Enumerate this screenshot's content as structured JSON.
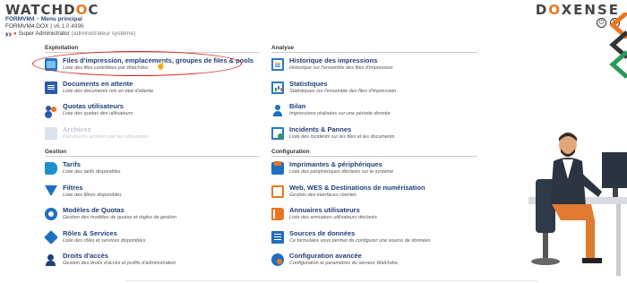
{
  "header": {
    "logo_left_main": "WATCHD",
    "logo_left_accent": "O",
    "logo_left_end": "C",
    "logo_right_start": "D",
    "logo_right_accent": "O",
    "logo_right_end": "XENSE",
    "breadcrumb_root": "FORMVM4",
    "breadcrumb_sep": ">",
    "breadcrumb_page": "Menu principal",
    "server": "FORMVM4.DOX",
    "version": "v6.1.0.4996",
    "user_role": "Super Administrator",
    "role_note": "(administrateur système)",
    "actions": [
      "power-icon",
      "refresh-icon"
    ]
  },
  "sections": {
    "exploitation": {
      "title": "Exploitation",
      "items": [
        {
          "label": "Files d'impression, emplacements, groupes de files & pools",
          "desc": "Liste des files contrôlées par Watchdoc",
          "icon": "print-queues-icon"
        },
        {
          "label": "Documents en attente",
          "desc": "Liste des documents mis en état d'attente",
          "icon": "pending-documents-icon"
        },
        {
          "label": "Quotas utilisateurs",
          "desc": "Liste des quotas des utilisateurs",
          "icon": "user-quotas-icon"
        },
        {
          "label": "Archives",
          "desc": "Documents archivés par les utilisateurs",
          "icon": "archives-icon"
        }
      ]
    },
    "gestion": {
      "title": "Gestion",
      "items": [
        {
          "label": "Tarifs",
          "desc": "Liste des tarifs disponibles",
          "icon": "pricing-icon"
        },
        {
          "label": "Filtres",
          "desc": "Liste des filtres disponibles",
          "icon": "filter-icon"
        },
        {
          "label": "Modèles de Quotas",
          "desc": "Gestion des modèles de quotas et règles de gestion",
          "icon": "quota-templates-icon"
        },
        {
          "label": "Rôles & Services",
          "desc": "Liste des rôles et services disponibles",
          "icon": "roles-services-icon"
        },
        {
          "label": "Droits d'accès",
          "desc": "Gestion des droits d'accès et profils d'administration",
          "icon": "access-rights-icon"
        }
      ]
    },
    "analyse": {
      "title": "Analyse",
      "items": [
        {
          "label": "Historique des impressions",
          "desc": "Historique sur l'ensemble des files d'impression",
          "icon": "print-history-icon"
        },
        {
          "label": "Statistiques",
          "desc": "Statistiques sur l'ensemble des files d'impression",
          "icon": "statistics-icon"
        },
        {
          "label": "Bilan",
          "desc": "Impressions réalisées sur une période donnée",
          "icon": "report-icon"
        },
        {
          "label": "Incidents & Pannes",
          "desc": "Liste des incidents sur les files et les documents",
          "icon": "incidents-icon"
        }
      ]
    },
    "configuration": {
      "title": "Configuration",
      "items": [
        {
          "label": "Imprimantes & périphériques",
          "desc": "Liste des périphériques déclarés sur le système",
          "icon": "printers-icon"
        },
        {
          "label": "Web, WES & Destinations de numérisation",
          "desc": "Gestion des interfaces clientes",
          "icon": "web-wes-icon"
        },
        {
          "label": "Annuaires utilisateurs",
          "desc": "Liste des annuaires utilisateurs déclarés",
          "icon": "user-directories-icon"
        },
        {
          "label": "Sources de données",
          "desc": "Ce formulaire vous permet de configurer une source de données",
          "icon": "data-sources-icon"
        },
        {
          "label": "Configuration avancée",
          "desc": "Configuration et paramètres du serveur Watchdoc",
          "icon": "advanced-config-icon"
        }
      ]
    }
  },
  "colors": {
    "link_blue": "#1f3f7a",
    "accent_orange": "#e87722",
    "highlight_red": "#d81e1e",
    "disabled": "#bfc6d0"
  }
}
